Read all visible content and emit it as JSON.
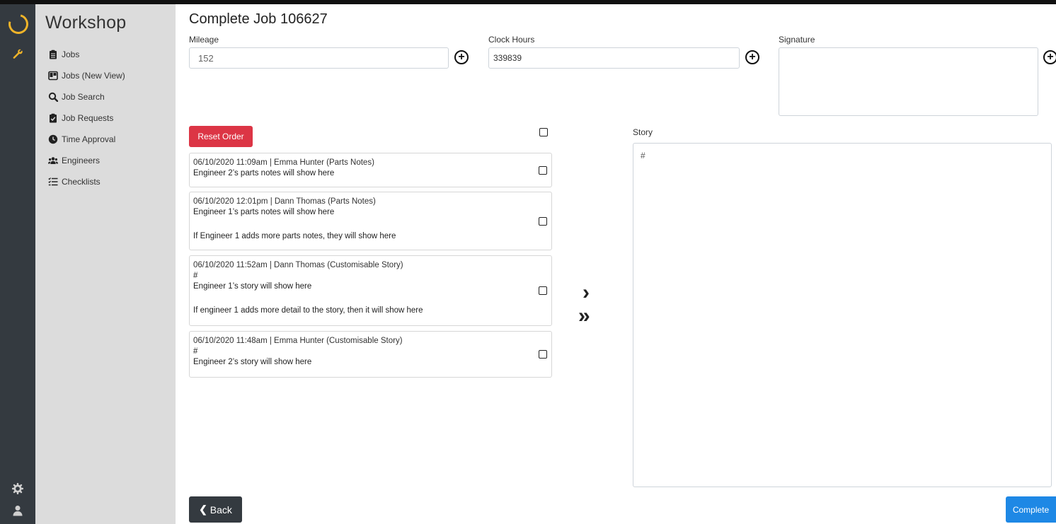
{
  "app": {
    "brand": "Workshop"
  },
  "rail": {
    "icons": [
      "logo-icon",
      "wrench-icon",
      "gear-icon",
      "user-icon"
    ]
  },
  "sidebar": {
    "items": [
      {
        "label": "Jobs",
        "icon": "clipboard-icon"
      },
      {
        "label": "Jobs (New View)",
        "icon": "columns-icon"
      },
      {
        "label": "Job Search",
        "icon": "search-icon"
      },
      {
        "label": "Job Requests",
        "icon": "clipboard-check-icon"
      },
      {
        "label": "Time Approval",
        "icon": "clock-icon"
      },
      {
        "label": "Engineers",
        "icon": "users-icon"
      },
      {
        "label": "Checklists",
        "icon": "tasks-icon"
      }
    ]
  },
  "page": {
    "title": "Complete Job 106627"
  },
  "fields": {
    "mileage": {
      "label": "Mileage",
      "value": "152"
    },
    "clock_hours": {
      "label": "Clock Hours",
      "value": "339839"
    },
    "signature": {
      "label": "Signature"
    }
  },
  "buttons": {
    "reset": "Reset Order",
    "back": "Back",
    "complete": "Complete",
    "plus": "+"
  },
  "notes": [
    {
      "meta": "06/10/2020 11:09am | Emma Hunter (Parts Notes)",
      "lines": [
        "Engineer 2’s parts notes will show here"
      ]
    },
    {
      "meta": "06/10/2020 12:01pm | Dann Thomas (Parts Notes)",
      "lines": [
        "Engineer 1’s parts notes will show here",
        "",
        "If Engineer 1 adds more parts notes, they will show here"
      ]
    },
    {
      "meta": "06/10/2020 11:52am | Dann Thomas (Customisable Story)",
      "lines": [
        "#",
        "Engineer 1’s story will show here",
        "",
        "If engineer 1 adds more detail to the story, then it will show here"
      ]
    },
    {
      "meta": "06/10/2020 11:48am | Emma Hunter (Customisable Story)",
      "lines": [
        "#",
        "Engineer 2’s story will show here"
      ]
    }
  ],
  "arrows": {
    "single": "›",
    "double": "»"
  },
  "story": {
    "label": "Story",
    "value": "#"
  }
}
